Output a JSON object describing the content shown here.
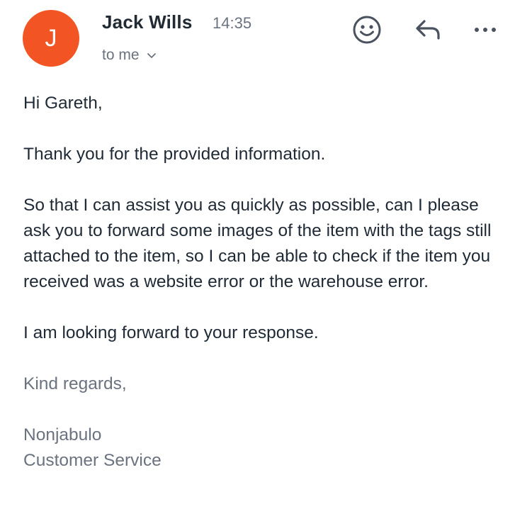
{
  "header": {
    "avatar_letter": "J",
    "avatar_color": "#f25523",
    "sender_name": "Jack Wills",
    "time": "14:35",
    "recipient": "to me",
    "icons": [
      "emoji-icon",
      "reply-icon",
      "more-icon"
    ]
  },
  "message": {
    "greeting": "Hi Gareth,",
    "paragraph_1": "Thank you for the provided information.",
    "paragraph_2": "So that I can assist you as quickly as possible, can I please ask you to forward some images of the item with the tags still attached to the item, so I can be able to check if the item you received was a website error or the warehouse error.",
    "paragraph_3": "I am looking forward to your response.",
    "closing": "Kind regards,",
    "signature_name": "Nonjabulo",
    "signature_title": "Customer Service"
  }
}
